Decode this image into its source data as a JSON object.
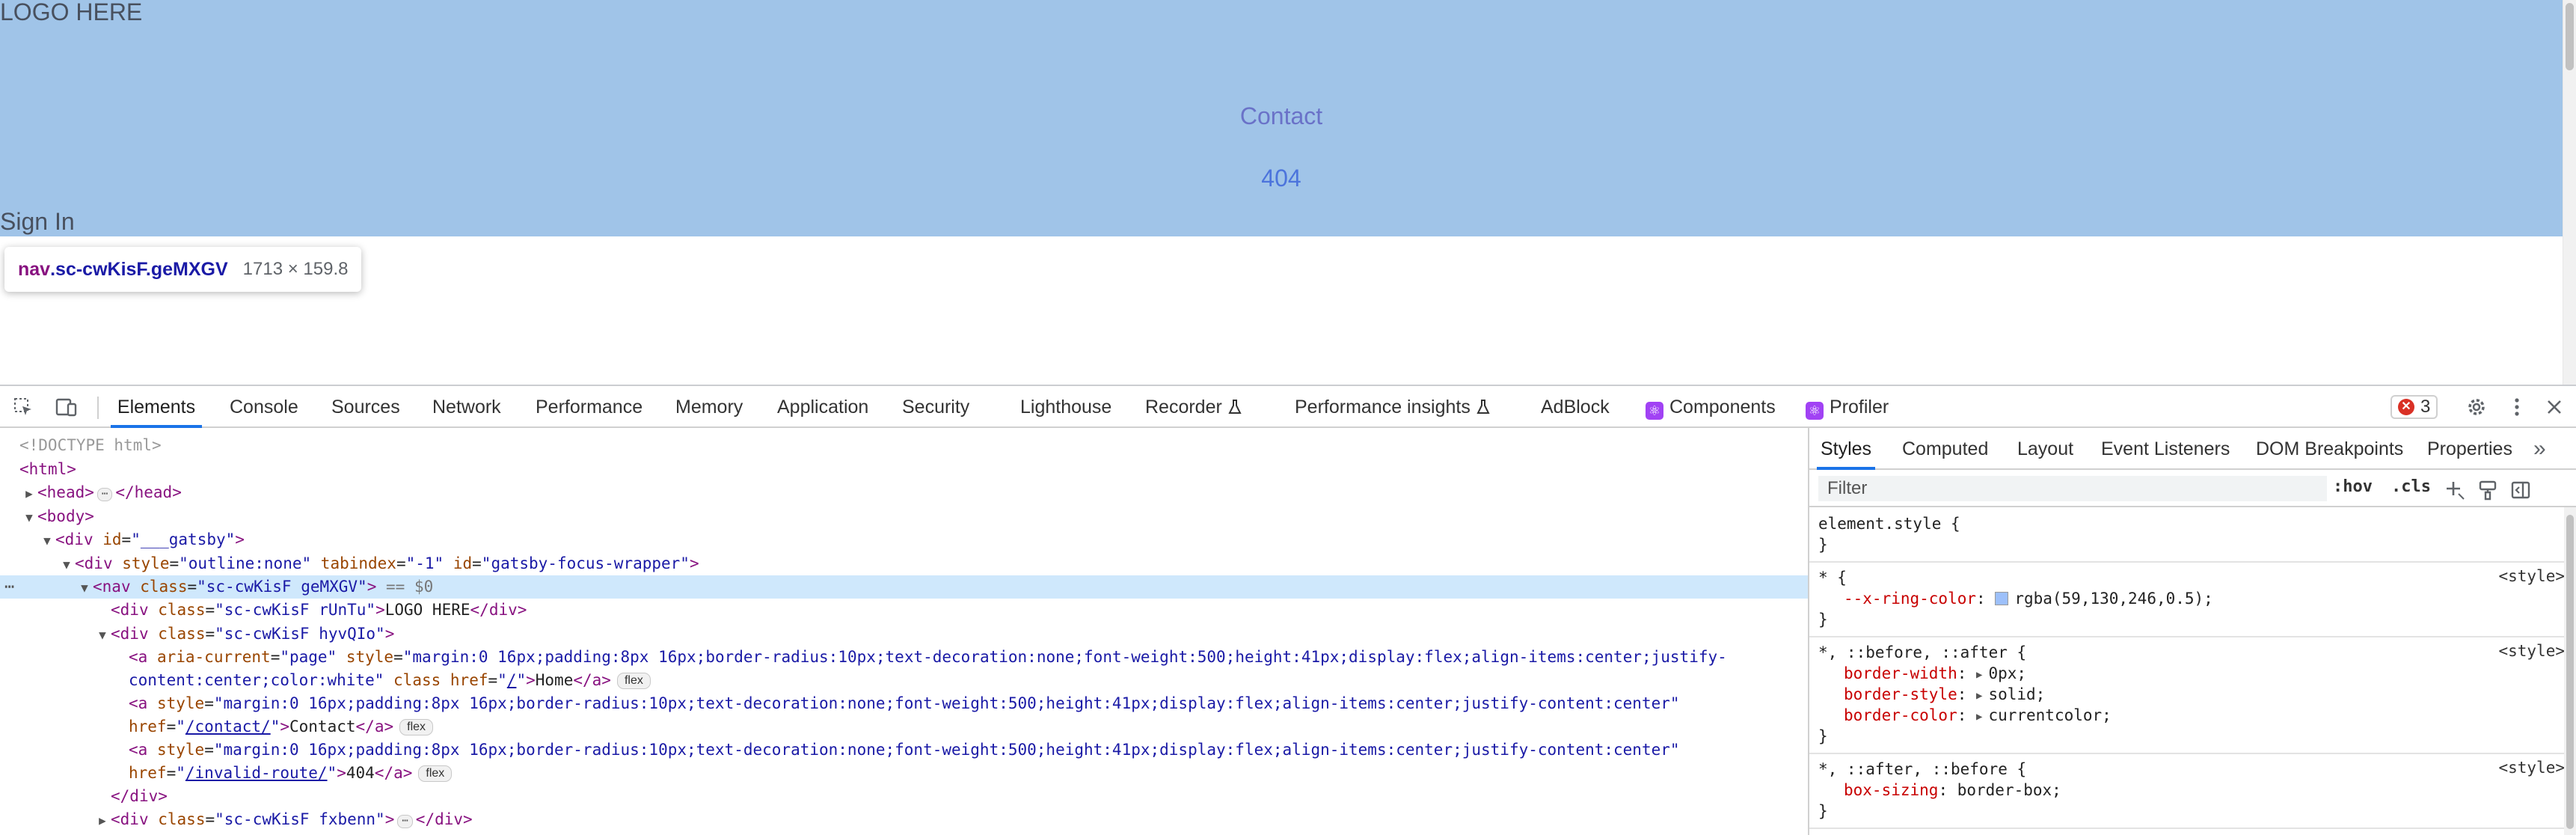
{
  "page": {
    "logo": "LOGO HERE",
    "links": [
      "Contact",
      "404"
    ],
    "signin": "Sign In",
    "tooltip": {
      "tag": "nav",
      "cls": ".sc-cwKisF.geMXGV",
      "size": "1713 × 159.8"
    },
    "colors": {
      "nav_bg": "#a0c4e8",
      "contact": "#6a72c8",
      "link404": "#4c74dc"
    }
  },
  "devtools": {
    "tabs": [
      "Elements",
      "Console",
      "Sources",
      "Network",
      "Performance",
      "Memory",
      "Application",
      "Security",
      "Lighthouse",
      "Recorder",
      "Performance insights",
      "AdBlock",
      "Components",
      "Profiler"
    ],
    "active_tab": "Elements",
    "error_count": "3",
    "icons": [
      "inspect-element-icon",
      "device-toolbar-icon",
      "settings-gear-icon",
      "more-vert-icon",
      "close-icon"
    ],
    "elements": {
      "doctype": "<!DOCTYPE html>",
      "html": "html",
      "head": "head",
      "body": "body",
      "div": "div",
      "nav": "nav",
      "a": "a",
      "id_attr": "id",
      "style_attr": "style",
      "tabindex_attr": "tabindex",
      "class_attr": "class",
      "aria_attr": "aria-current",
      "href_attr": "href",
      "gatsby_id": "\"___gatsby\"",
      "wrapper_style": "\"outline:none\"",
      "wrapper_tabindex": "\"-1\"",
      "wrapper_id": "\"gatsby-focus-wrapper\"",
      "nav_class": "\"sc-cwKisF geMXGV\"",
      "sel_marker": "== $0",
      "logo_class": "\"sc-cwKisF rUnTu\"",
      "logo_text": "LOGO HERE",
      "links_class": "\"sc-cwKisF hyvQIo\"",
      "aria_val": "\"page\"",
      "home_style_1": "\"margin:0 16px;padding:8px 16px;border-radius:10px;text-decoration:none;font-weight:500;height:41px;display:flex;align-items:center;justify-",
      "home_style_2": "content:center;color:white\"",
      "home_href": "/",
      "home_text": "Home",
      "link_style": "\"margin:0 16px;padding:8px 16px;border-radius:10px;text-decoration:none;font-weight:500;height:41px;display:flex;align-items:center;justify-content:center\"",
      "contact_href": "/contact/",
      "contact_text": "Contact",
      "invalid_href": "/invalid-route/",
      "invalid_text": "404",
      "last_class": "\"sc-cwKisF fxbenn\"",
      "flex_badge": "flex",
      "ellipsis": "⋯"
    },
    "styles": {
      "tabs": [
        "Styles",
        "Computed",
        "Layout",
        "Event Listeners",
        "DOM Breakpoints",
        "Properties"
      ],
      "active": "Styles",
      "overflow": "»",
      "filter_placeholder": "Filter",
      "hov": ":hov",
      "cls": ".cls",
      "rules": [
        {
          "selector": "element.style {",
          "source": "",
          "decls": []
        },
        {
          "selector": "* {",
          "source": "<style>",
          "decls": [
            {
              "prop": "--x-ring-color",
              "value": "rgba(59,130,246,0.5);",
              "swatch": "#9cc0fa"
            }
          ]
        },
        {
          "selector": "*, ::before, ::after {",
          "source": "<style>",
          "decls": [
            {
              "prop": "border-width",
              "value": "0px;"
            },
            {
              "prop": "border-style",
              "value": "solid;"
            },
            {
              "prop": "border-color",
              "value": "currentcolor;"
            }
          ]
        },
        {
          "selector": "*, ::after, ::before {",
          "source": "<style>",
          "decls": [
            {
              "prop": "box-sizing",
              "value": "border-box;"
            }
          ]
        }
      ],
      "close_brace": "}"
    }
  }
}
